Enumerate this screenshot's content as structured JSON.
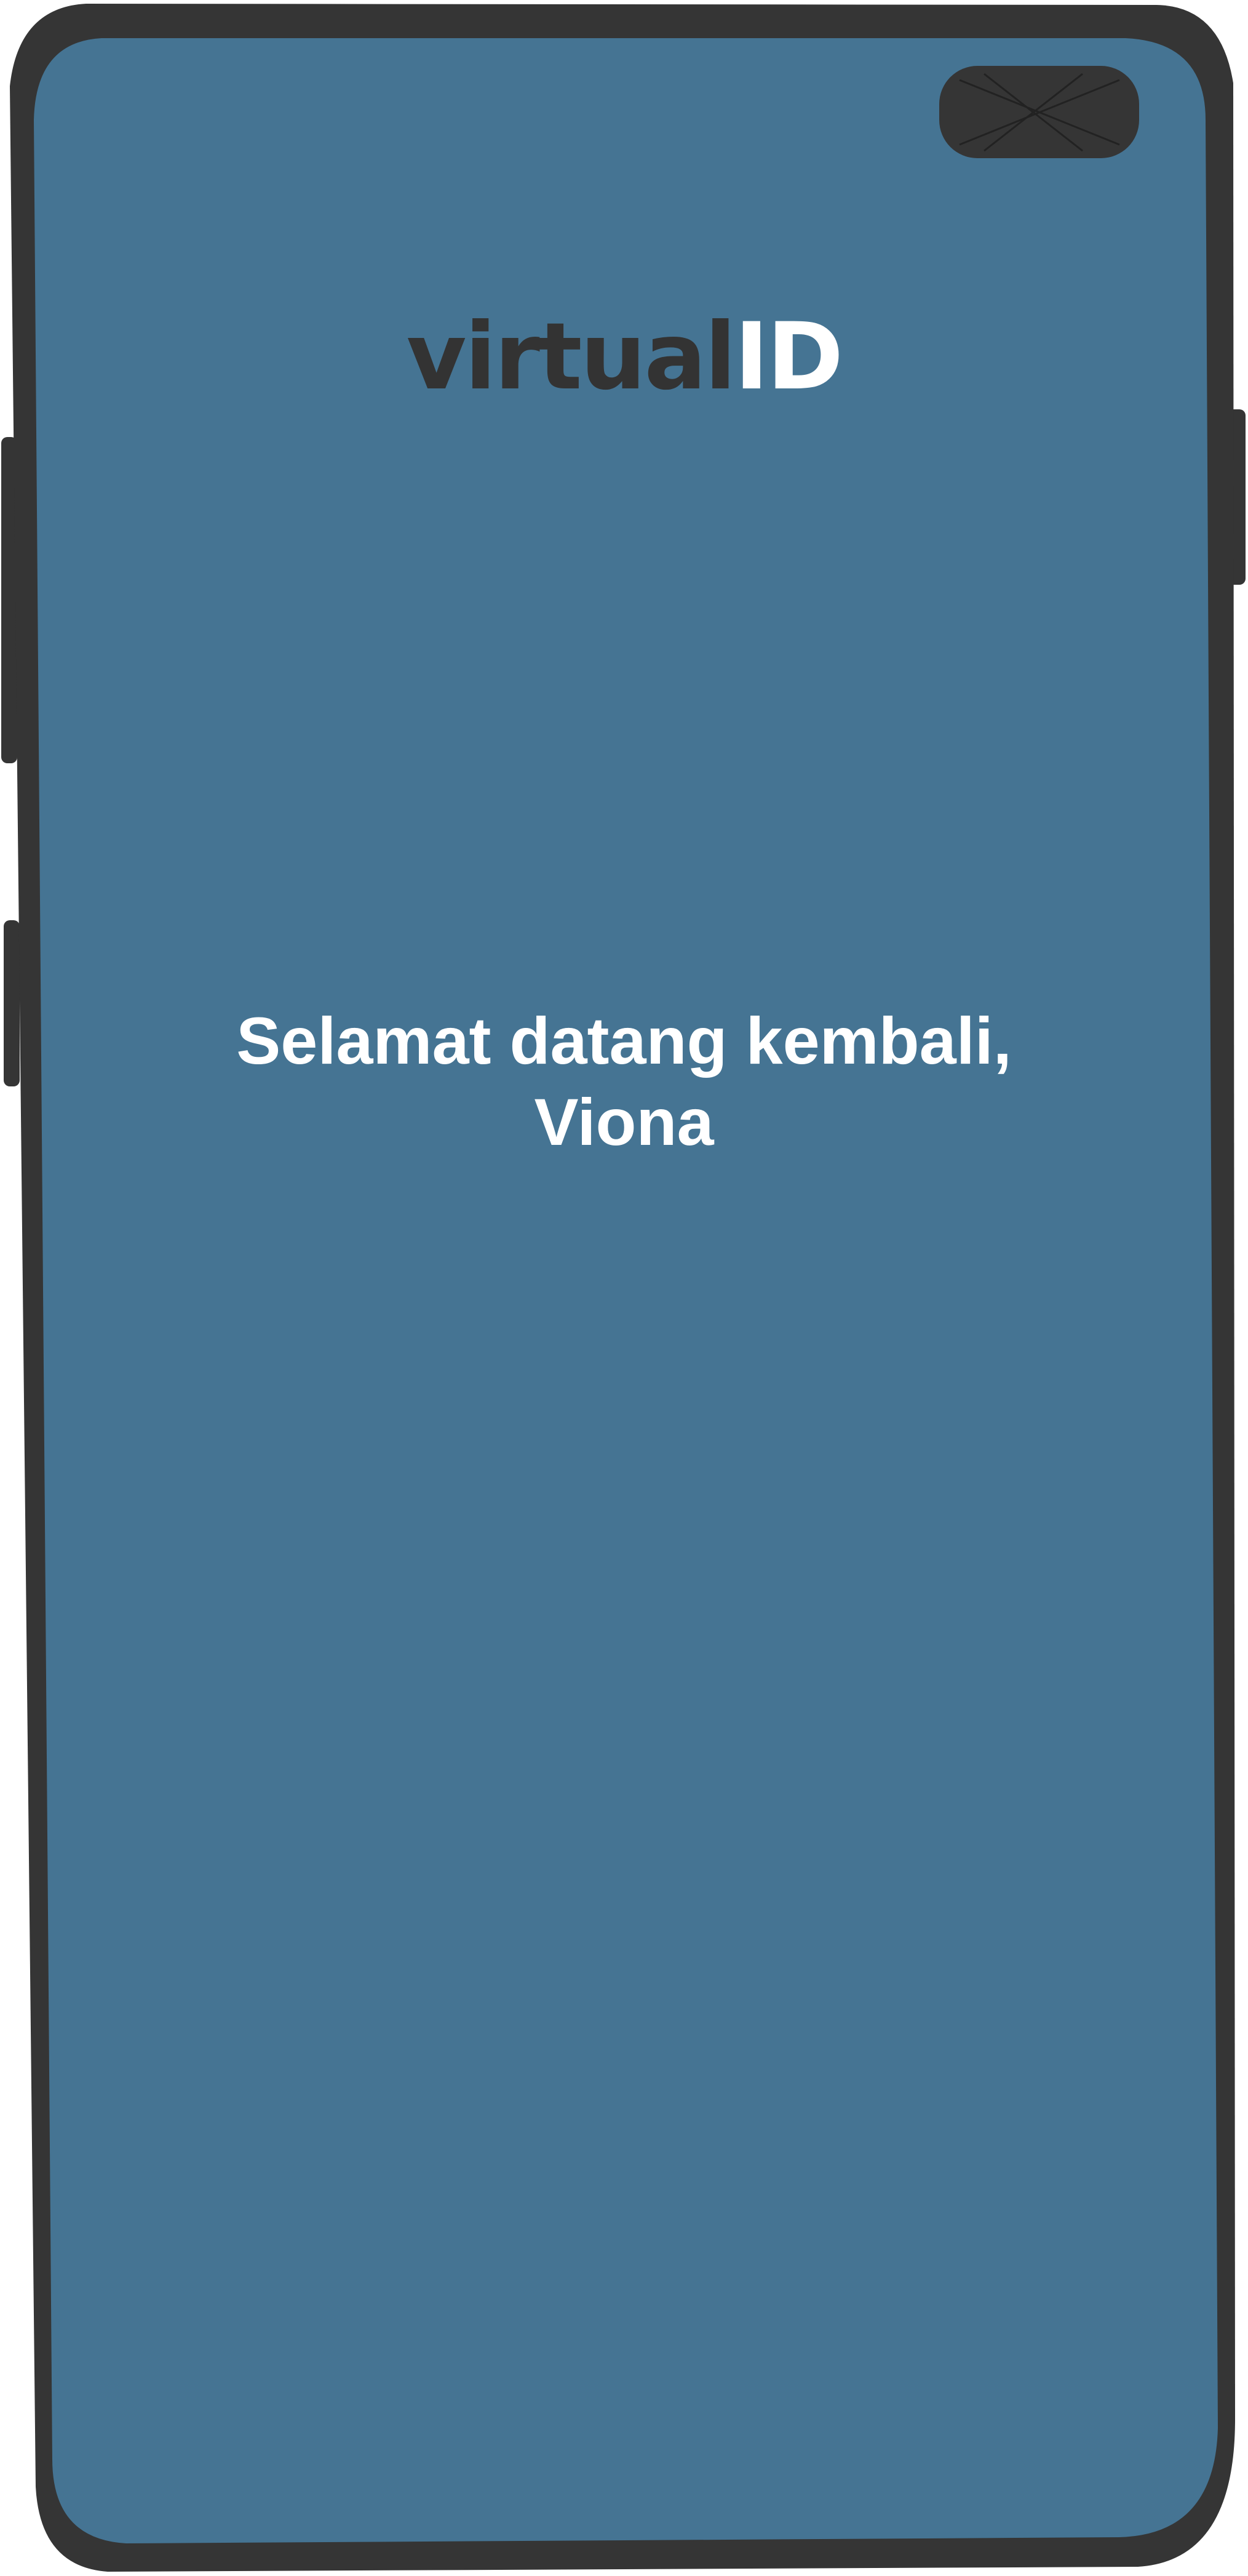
{
  "logo": {
    "part1": "virtual",
    "part2": "ID"
  },
  "welcome": {
    "line1": "Selamat datang kembali,",
    "line2": "Viona"
  },
  "colors": {
    "screen": "#457493",
    "frame": "#353535",
    "logo_dark": "#333333",
    "logo_light": "#ffffff",
    "text": "#ffffff"
  }
}
